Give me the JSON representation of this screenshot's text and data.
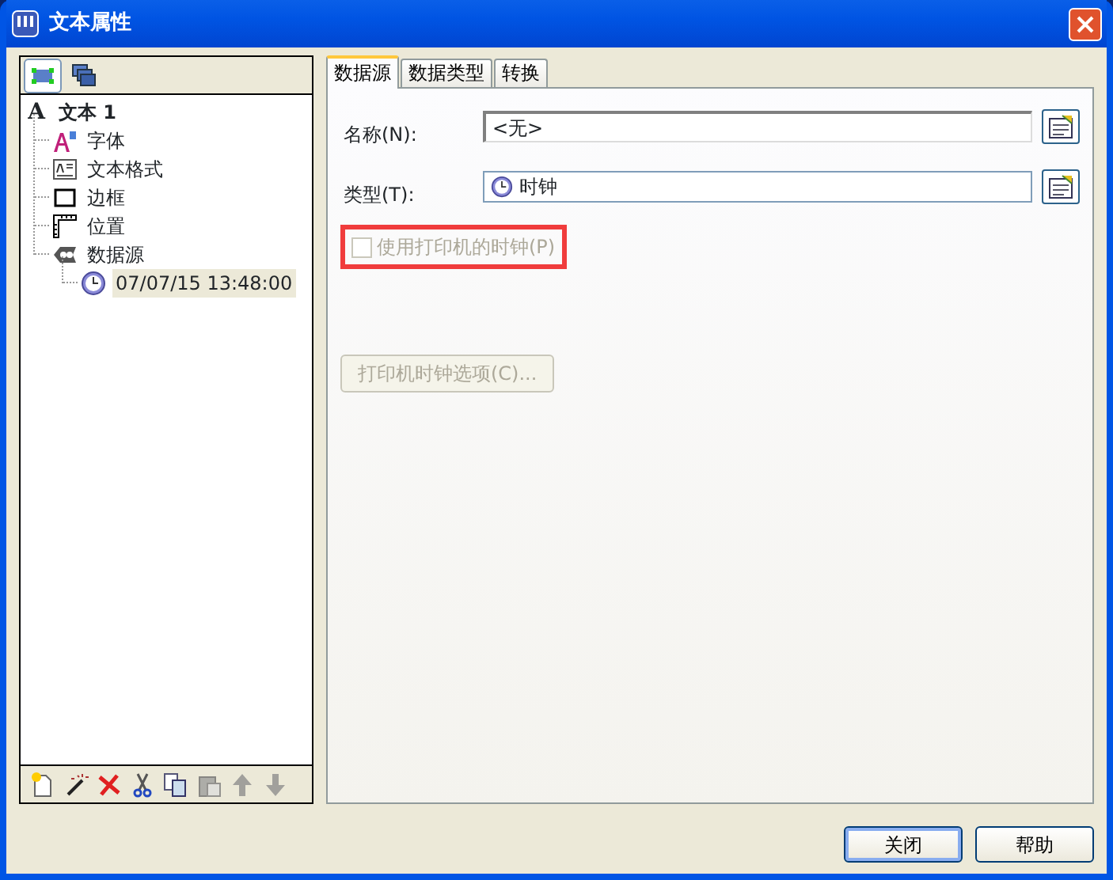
{
  "window": {
    "title": "文本属性"
  },
  "view_buttons": [
    {
      "kind": "nodes",
      "selected": true
    },
    {
      "kind": "layers",
      "selected": false
    }
  ],
  "tree": [
    {
      "label": "文本 1",
      "glyph": "A",
      "selected": false,
      "children": [
        {
          "label": "字体",
          "kind": "font",
          "selected": false
        },
        {
          "label": "文本格式",
          "kind": "format",
          "selected": false
        },
        {
          "label": "边框",
          "kind": "border",
          "selected": false
        },
        {
          "label": "位置",
          "kind": "position",
          "selected": false
        },
        {
          "label": "数据源",
          "kind": "source",
          "selected": false,
          "children": [
            {
              "label": "07/07/15 13:48:00",
              "kind": "clock",
              "selected": true
            }
          ]
        }
      ]
    }
  ],
  "tree_toolbar": [
    {
      "kind": "new",
      "disabled": false
    },
    {
      "kind": "wizard",
      "disabled": false
    },
    {
      "kind": "delete",
      "disabled": false
    },
    {
      "kind": "cut",
      "disabled": false
    },
    {
      "kind": "copy",
      "disabled": false
    },
    {
      "kind": "paste",
      "disabled": true
    },
    {
      "kind": "up",
      "disabled": true
    },
    {
      "kind": "down",
      "disabled": true
    }
  ],
  "tabs": [
    {
      "label": "数据源",
      "selected": true
    },
    {
      "label": "数据类型",
      "selected": false
    },
    {
      "label": "转换",
      "selected": false
    }
  ],
  "fields": [
    {
      "label": "名称(N):",
      "value": "<无>",
      "kind": "text"
    },
    {
      "label": "类型(T):",
      "value": "时钟",
      "kind": "clock"
    }
  ],
  "checkbox": {
    "label": "使用打印机的时钟(P)",
    "checked": false,
    "disabled": true,
    "highlighted": true
  },
  "options_button": {
    "label": "打印机时钟选项(C)...",
    "disabled": true
  },
  "buttons": [
    {
      "label": "关闭",
      "default": true
    },
    {
      "label": "帮助",
      "default": false
    }
  ]
}
